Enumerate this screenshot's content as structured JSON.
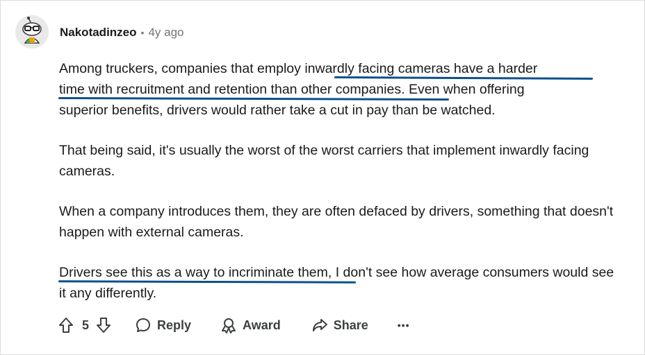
{
  "comment": {
    "username": "Nakotadinzeo",
    "separator": "•",
    "time": "4y ago",
    "paragraphs": {
      "p1": {
        "line1_a": "Among truckers, companies that employ ",
        "line1_b": "inwardly facing cameras have a harder",
        "line2_a": "time with recruitment and retention than ",
        "line2_b": "other companies",
        "line2_c": ". Even when offering",
        "line3": "superior benefits, drivers would rather take a cut in pay than be watched."
      },
      "p2": "That being said, it's usually the worst of the worst carriers that implement inwardly facing cameras.",
      "p3": "When a company introduces them, they are often defaced by drivers, something that doesn't happen with external cameras.",
      "p4": {
        "a": "Drivers see this as a way to incriminate them",
        "b": ", I don't see how average consumers would see it any differently."
      }
    }
  },
  "actions": {
    "vote_count": "5",
    "reply_label": "Reply",
    "award_label": "Award",
    "share_label": "Share",
    "more_label": "•••"
  },
  "colors": {
    "highlight_underline": "#0d4f8e",
    "text": "#1a1a1b",
    "meta": "#6f7375"
  }
}
